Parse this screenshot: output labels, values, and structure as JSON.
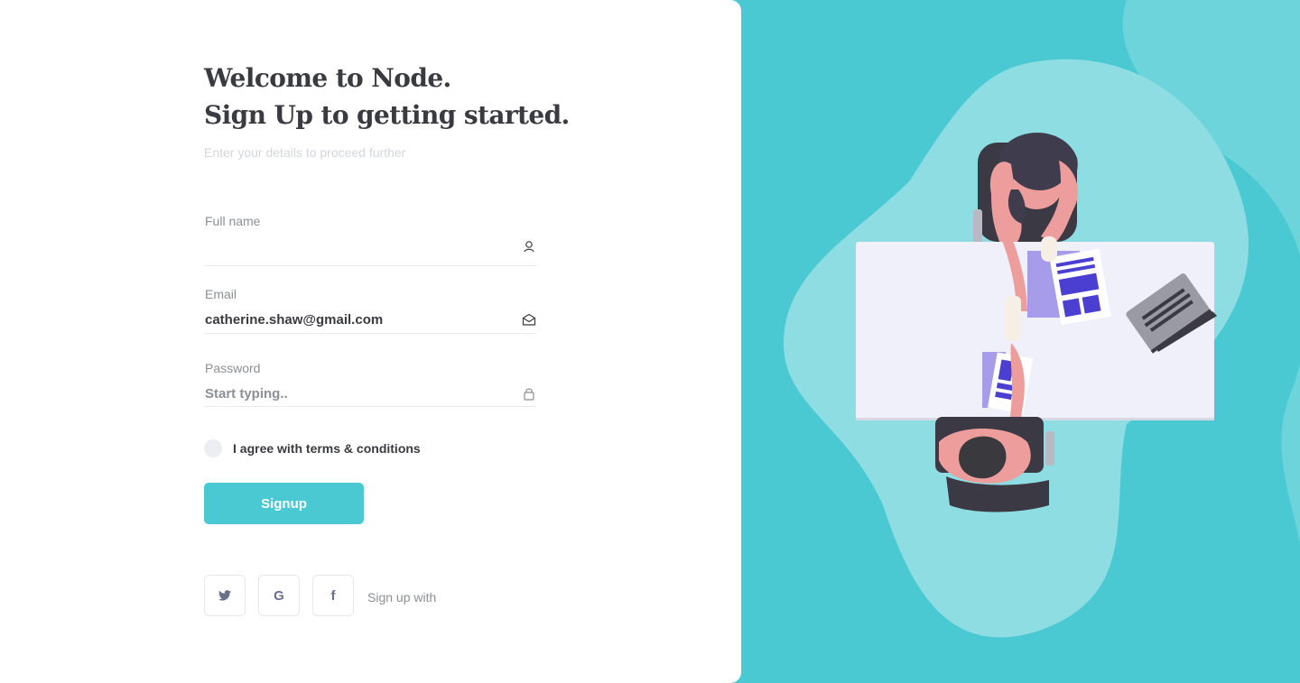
{
  "heading": {
    "line1": "Welcome to Node.",
    "line2": "Sign Up to getting started."
  },
  "subtitle": "Enter your details to proceed further",
  "form": {
    "full_name": {
      "label": "Full name",
      "value": "",
      "placeholder": "",
      "icon": "user-icon"
    },
    "email": {
      "label": "Email",
      "value": "catherine.shaw@gmail.com",
      "icon": "envelope-icon"
    },
    "password": {
      "label": "Password",
      "value": "",
      "placeholder": "Start typing..",
      "icon": "lock-icon"
    },
    "agree_label": "I agree with terms & conditions",
    "agree_checked": false,
    "submit_label": "Signup"
  },
  "social": {
    "twitter_glyph": "🐦",
    "google_glyph": "G",
    "facebook_glyph": "f",
    "label": "Sign up with"
  },
  "colors": {
    "accent": "#4bc9d3",
    "text_dark": "#3a3b40",
    "text_muted": "#8c8f97",
    "illustration_purple": "#4b3fd1"
  }
}
